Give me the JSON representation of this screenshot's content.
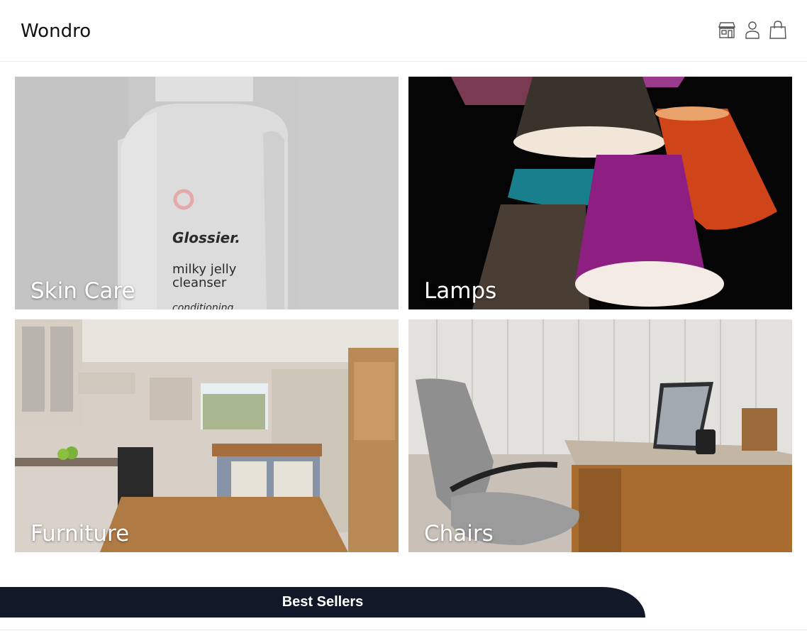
{
  "header": {
    "brand": "Wondro",
    "icons": [
      "store-icon",
      "user-icon",
      "shopping-bag-icon"
    ]
  },
  "categories": [
    {
      "label": "Skin Care",
      "image": "skincare-bottle",
      "bottle_brand": "Glossier.",
      "bottle_product": "milky jelly\ncleanser",
      "bottle_sub": "conditioning"
    },
    {
      "label": "Lamps",
      "image": "colorful-lampshades"
    },
    {
      "label": "Furniture",
      "image": "kitchen-interior"
    },
    {
      "label": "Chairs",
      "image": "office-desk-chair"
    }
  ],
  "section": {
    "title": "Best Sellers"
  },
  "colors": {
    "banner_bg": "#111827",
    "label_text": "#ffffff"
  }
}
